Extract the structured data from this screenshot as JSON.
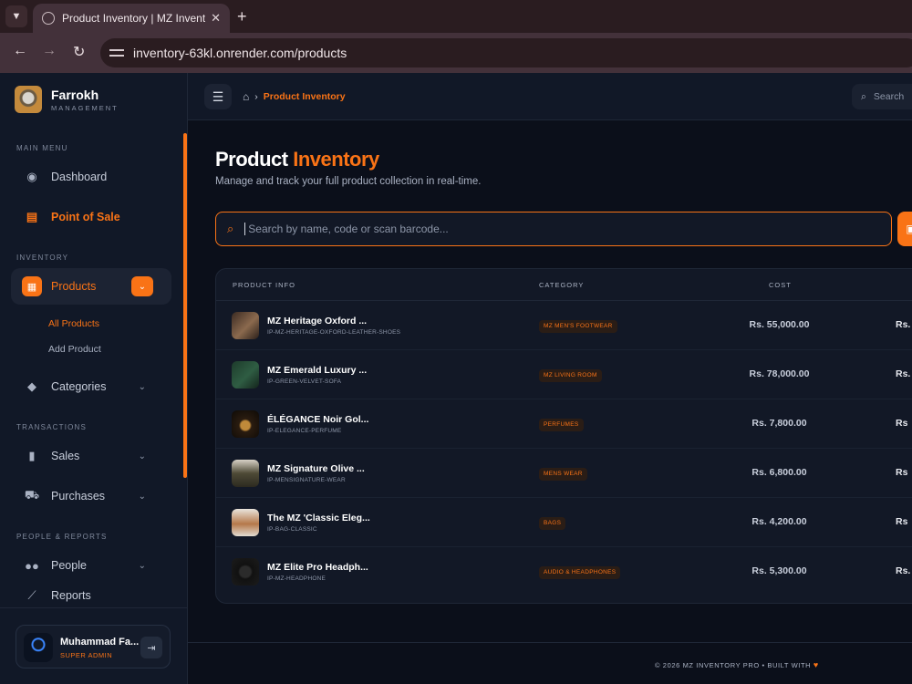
{
  "browser": {
    "tab_title": "Product Inventory | MZ Inventory",
    "url": "inventory-63kl.onrender.com/products"
  },
  "sidebar": {
    "brand_name": "Farrokh",
    "brand_sub": "MANAGEMENT",
    "sections": {
      "main": "MAIN MENU",
      "inventory": "INVENTORY",
      "transactions": "TRANSACTIONS",
      "people": "PEOPLE & REPORTS"
    },
    "items": {
      "dashboard": "Dashboard",
      "pos": "Point of Sale",
      "products": "Products",
      "all_products": "All Products",
      "add_product": "Add Product",
      "categories": "Categories",
      "sales": "Sales",
      "purchases": "Purchases",
      "people": "People",
      "reports": "Reports"
    },
    "user": {
      "name": "Muhammad Fa...",
      "role": "SUPER ADMIN"
    }
  },
  "header": {
    "breadcrumb_current": "Product Inventory",
    "search_placeholder": "Search"
  },
  "main": {
    "title_part1": "Product",
    "title_part2": "Inventory",
    "subtitle": "Manage and track your full product collection in real-time.",
    "search_placeholder": "Search by name, code or scan barcode...",
    "columns": {
      "product": "PRODUCT INFO",
      "category": "CATEGORY",
      "cost": "COST"
    },
    "rows": [
      {
        "name": "MZ Heritage Oxford ...",
        "code": "IP-MZ-HERITAGE-OXFORD-LEATHER-SHOES",
        "category": "MZ MEN'S FOOTWEAR",
        "cost": "Rs. 55,000.00",
        "price": "Rs."
      },
      {
        "name": "MZ Emerald Luxury ...",
        "code": "IP-GREEN-VELVET-SOFA",
        "category": "MZ LIVING ROOM",
        "cost": "Rs. 78,000.00",
        "price": "Rs."
      },
      {
        "name": "ÉLÉGANCE Noir Gol...",
        "code": "IP-ELEGANCE-PERFUME",
        "category": "PERFUMES",
        "cost": "Rs. 7,800.00",
        "price": "Rs"
      },
      {
        "name": "MZ Signature Olive ...",
        "code": "IP-MENSIGNATURE-WEAR",
        "category": "MENS WEAR",
        "cost": "Rs. 6,800.00",
        "price": "Rs"
      },
      {
        "name": "The MZ 'Classic Eleg...",
        "code": "IP-BAG-CLASSIC",
        "category": "BAGS",
        "cost": "Rs. 4,200.00",
        "price": "Rs"
      },
      {
        "name": "MZ Elite Pro Headph...",
        "code": "IP-MZ-HEADPHONE",
        "category": "AUDIO & HEADPHONES",
        "cost": "Rs. 5,300.00",
        "price": "Rs."
      }
    ]
  },
  "footer": {
    "text": "© 2026 MZ INVENTORY PRO • BUILT WITH"
  },
  "colors": {
    "accent": "#f97316",
    "bg": "#0b0f1a",
    "sidebar": "#111827"
  }
}
